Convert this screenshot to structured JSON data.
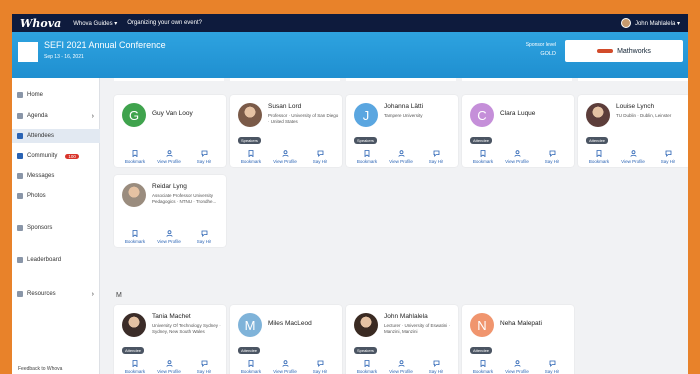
{
  "topnav": {
    "logo": "Whova",
    "guides": "Whova Guides ▾",
    "organize": "Organizing your own event?",
    "user": "John Mahlalela ▾"
  },
  "banner": {
    "title": "SEFI 2021 Annual Conference",
    "date": "Sep 13 - 16, 2021",
    "sponsor_level_label": "Sponsor level",
    "sponsor_level": "GOLD",
    "sponsor_name": "Mathworks"
  },
  "sidebar": {
    "items": [
      {
        "label": "Home"
      },
      {
        "label": "Agenda"
      },
      {
        "label": "Attendees"
      },
      {
        "label": "Community",
        "badge": "100"
      },
      {
        "label": "Messages"
      },
      {
        "label": "Photos"
      },
      {
        "label": "Sponsors"
      },
      {
        "label": "Leaderboard"
      },
      {
        "label": "Resources"
      }
    ],
    "feedback": "Feedback to Whova"
  },
  "actions": {
    "bookmark": "Bookmark",
    "profile": "View Profile",
    "hi": "Say Hi!"
  },
  "section_letter": "M",
  "colors": {
    "accent": "#2ea3e0",
    "brand_dark": "#0e1b3d",
    "frame": "#e8822a",
    "link": "#2a63b4"
  },
  "attendees": [
    {
      "name": "Guy Van Looy",
      "subtitle": "",
      "tag": "",
      "avatar": "G",
      "avatar_color": "#3fa34d"
    },
    {
      "name": "Susan Lord",
      "subtitle": "Professor · University of San Diego · United States",
      "tag": "Speakers",
      "avatar": "",
      "avatar_color": "#7a5a48"
    },
    {
      "name": "Johanna Lätti",
      "subtitle": "Tampere University",
      "tag": "Speakers",
      "avatar": "J",
      "avatar_color": "#5aa6e0"
    },
    {
      "name": "Clara Luque",
      "subtitle": "",
      "tag": "Attendee",
      "avatar": "C",
      "avatar_color": "#c58fd9"
    },
    {
      "name": "Louise Lynch",
      "subtitle": "TU Dublin · Dublin, Leinster",
      "tag": "Attendee",
      "avatar": "",
      "avatar_color": "#5c3d3a"
    },
    {
      "name": "Reidar Lyng",
      "subtitle": "Associate Professor University Pedagogics · NTNU · Trondhe...",
      "tag": "",
      "avatar": "",
      "avatar_color": "#9a8c7e"
    },
    {
      "name": "Tania Machet",
      "subtitle": "University Of Technology Sydney · Sydney, New South Wales",
      "tag": "Attendee",
      "avatar": "",
      "avatar_color": "#3b2c28"
    },
    {
      "name": "Miles MacLeod",
      "subtitle": "",
      "tag": "Attendee",
      "avatar": "M",
      "avatar_color": "#7fb3d9"
    },
    {
      "name": "John Mahlalela",
      "subtitle": "Lecturer · University of Eswatini · Manzini, Manzini",
      "tag": "Speakers",
      "avatar": "",
      "avatar_color": "#3a2a22"
    },
    {
      "name": "Neha Malepati",
      "subtitle": "",
      "tag": "Attendee",
      "avatar": "N",
      "avatar_color": "#f0956e"
    }
  ]
}
